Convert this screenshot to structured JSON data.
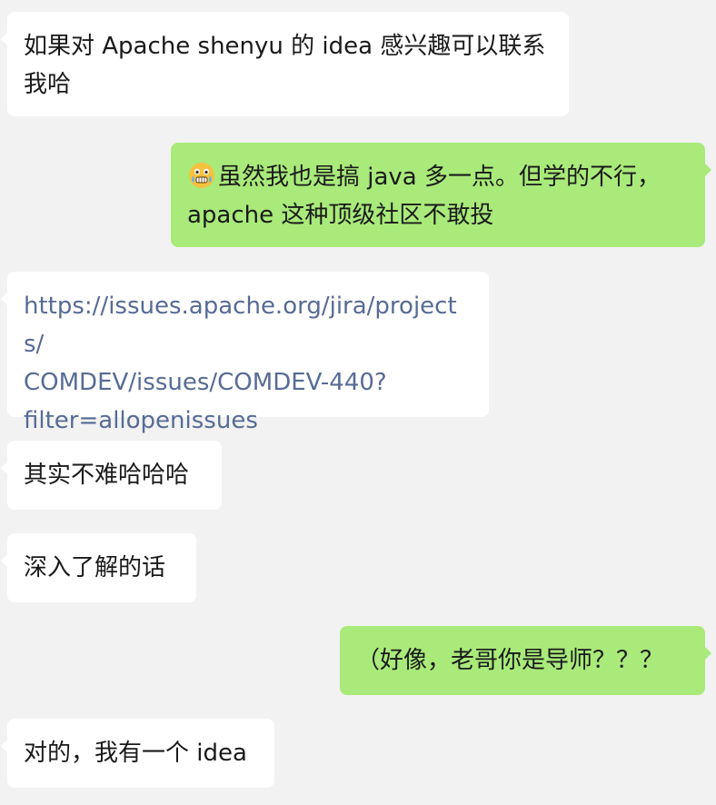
{
  "messages": [
    {
      "side": "in",
      "lines": [
        "如果对 Apache shenyu 的 idea 感兴趣可以联系",
        "我哈"
      ]
    },
    {
      "side": "out",
      "emoji": "grimacing-tears-face",
      "lines": [
        "虽然我也是搞 java 多一点。但学的不行，",
        "apache 这种顶级社区不敢投"
      ]
    },
    {
      "side": "in",
      "link": true,
      "lines": [
        "https://issues.apache.org/jira/projects/",
        "COMDEV/issues/COMDEV-440?",
        "filter=allopenissues"
      ]
    },
    {
      "side": "in",
      "lines": [
        "其实不难哈哈哈"
      ]
    },
    {
      "side": "in",
      "lines": [
        "深入了解的话"
      ]
    },
    {
      "side": "out",
      "lines": [
        "（好像，老哥你是导师？？？"
      ]
    },
    {
      "side": "in",
      "lines": [
        "对的，我有一个 idea"
      ]
    }
  ],
  "colors": {
    "background": "#f2f2f2",
    "incoming_bubble": "#ffffff",
    "outgoing_bubble": "#a9ea7a",
    "link": "#576b95",
    "text": "#1a1a1a"
  }
}
